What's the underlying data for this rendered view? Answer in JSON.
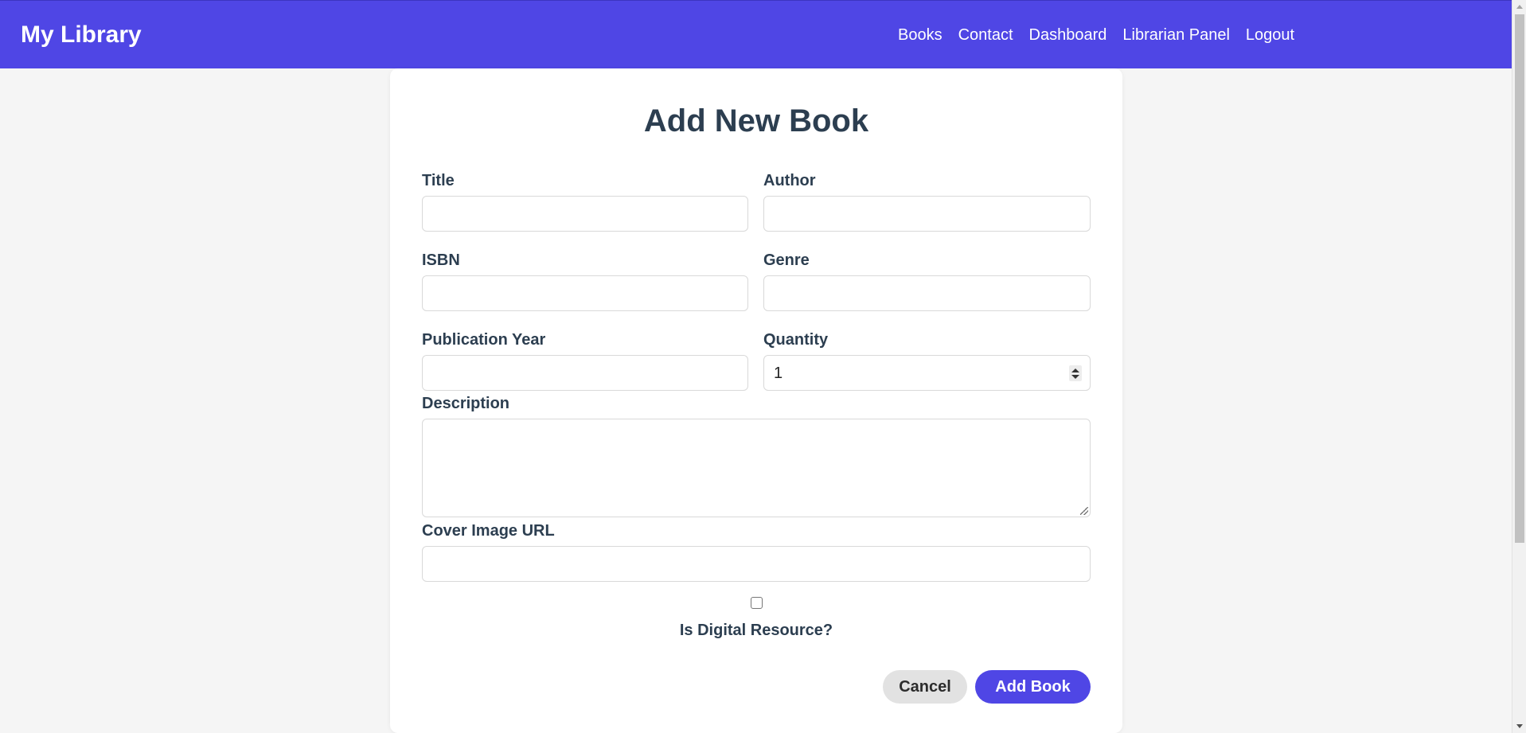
{
  "navbar": {
    "brand": "My Library",
    "links": [
      "Books",
      "Contact",
      "Dashboard",
      "Librarian Panel",
      "Logout"
    ]
  },
  "form": {
    "title": "Add New Book",
    "fields": {
      "title": {
        "label": "Title",
        "value": ""
      },
      "author": {
        "label": "Author",
        "value": ""
      },
      "isbn": {
        "label": "ISBN",
        "value": ""
      },
      "genre": {
        "label": "Genre",
        "value": ""
      },
      "publication_year": {
        "label": "Publication Year",
        "value": ""
      },
      "quantity": {
        "label": "Quantity",
        "value": "1"
      },
      "description": {
        "label": "Description",
        "value": ""
      },
      "cover_image_url": {
        "label": "Cover Image URL",
        "value": ""
      }
    },
    "digital_resource": {
      "label": "Is Digital Resource?",
      "checked": false
    },
    "buttons": {
      "cancel": "Cancel",
      "submit": "Add Book"
    }
  },
  "colors": {
    "primary": "#4f46e5",
    "heading": "#2c3e50",
    "background": "#f5f5f5",
    "cancel_bg": "#e2e2e2"
  }
}
